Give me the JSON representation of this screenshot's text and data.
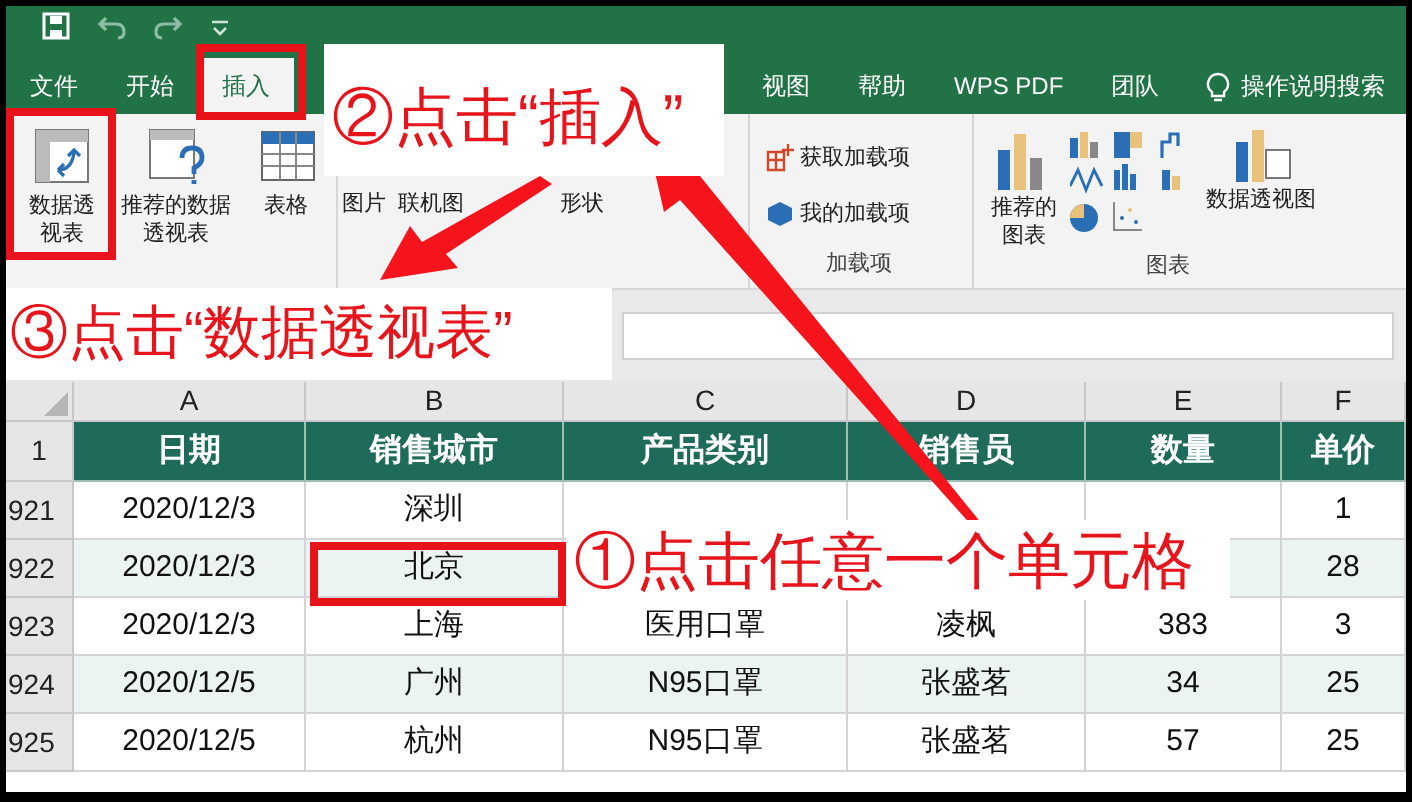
{
  "tabs": [
    {
      "label": "文件",
      "selected": false
    },
    {
      "label": "开始",
      "selected": false
    },
    {
      "label": "插入",
      "selected": true
    },
    {
      "label": "视图",
      "selected": false
    },
    {
      "label": "帮助",
      "selected": false
    },
    {
      "label": "WPS PDF",
      "selected": false
    },
    {
      "label": "团队",
      "selected": false
    }
  ],
  "tell_me": "操作说明搜索",
  "ribbon": {
    "tables": [
      {
        "label": "数据透视表",
        "kind": "pivot"
      },
      {
        "label": "推荐的数据透视表",
        "kind": "recommended"
      },
      {
        "label": "表格",
        "kind": "table"
      }
    ],
    "illustrations": [
      "图片",
      "联机图",
      "形状"
    ],
    "addins": {
      "items": [
        "获取加载项",
        "我的加载项"
      ],
      "label": "加载项"
    },
    "charts": {
      "recommended": "推荐的图表",
      "pivot_chart": "数据透视图",
      "label": "图表"
    }
  },
  "sheet": {
    "columns": [
      "A",
      "B",
      "C",
      "D",
      "E",
      "F"
    ],
    "header": {
      "row": "1",
      "cells": [
        "日期",
        "销售城市",
        "产品类别",
        "销售员",
        "数量",
        "单价"
      ]
    },
    "rows": [
      {
        "row": "921",
        "cells": [
          "2020/12/3",
          "深圳",
          null,
          null,
          null,
          "1"
        ]
      },
      {
        "row": "922",
        "cells": [
          "2020/12/3",
          "北京",
          null,
          null,
          null,
          "28"
        ]
      },
      {
        "row": "923",
        "cells": [
          "2020/12/3",
          "上海",
          "医用口罩",
          "凌枫",
          "383",
          "3"
        ]
      },
      {
        "row": "924",
        "cells": [
          "2020/12/5",
          "广州",
          "N95口罩",
          "张盛茗",
          "34",
          "25"
        ]
      },
      {
        "row": "925",
        "cells": [
          "2020/12/5",
          "杭州",
          "N95口罩",
          "张盛茗",
          "57",
          "25"
        ]
      }
    ]
  },
  "annotations": [
    {
      "text": "②点击“插入”"
    },
    {
      "text": "③点击“数据透视表”"
    },
    {
      "text": "①点击任意一个单元格"
    }
  ]
}
